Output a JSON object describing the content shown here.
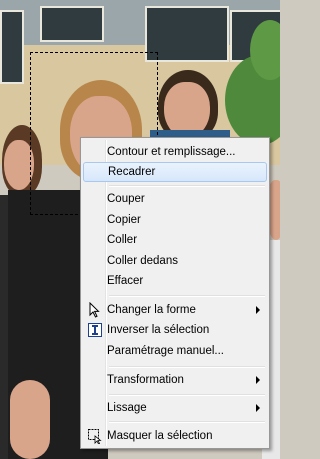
{
  "menu": {
    "items": [
      {
        "label": "Contour et remplissage..."
      },
      {
        "label": "Recadrer"
      },
      {
        "label": "Couper"
      },
      {
        "label": "Copier"
      },
      {
        "label": "Coller"
      },
      {
        "label": "Coller dedans"
      },
      {
        "label": "Effacer"
      },
      {
        "label": "Changer la forme",
        "icon": "arrow-cursor-icon"
      },
      {
        "label": "Inverser la sélection",
        "icon": "text-cursor-icon"
      },
      {
        "label": "Paramétrage manuel..."
      },
      {
        "label": "Transformation"
      },
      {
        "label": "Lissage"
      },
      {
        "label": "Masquer la sélection",
        "icon": "hide-selection-icon"
      }
    ],
    "highlighted": "Recadrer"
  },
  "colors": {
    "menu_background": "#f0f0f0",
    "highlight": "#d7e7fb",
    "highlight_border": "#a8c8f0"
  }
}
